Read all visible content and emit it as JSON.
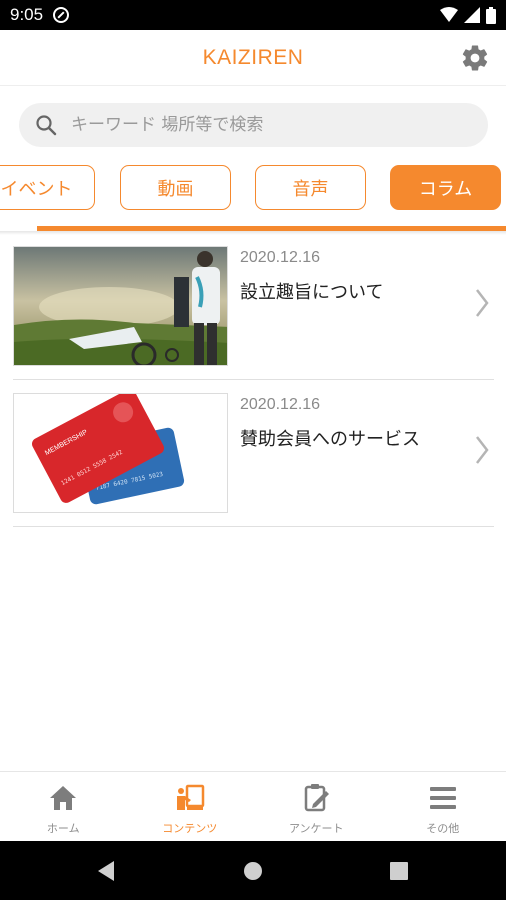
{
  "status_bar": {
    "time": "9:05"
  },
  "header": {
    "title": "KAIZIREN"
  },
  "search": {
    "placeholder": "キーワード 場所等で検索"
  },
  "tabs": [
    {
      "label": "イベント",
      "active": false
    },
    {
      "label": "動画",
      "active": false
    },
    {
      "label": "音声",
      "active": false
    },
    {
      "label": "コラム",
      "active": true
    }
  ],
  "articles": [
    {
      "date": "2020.12.16",
      "title": "設立趣旨について",
      "thumbnail": "wheelchair-photo"
    },
    {
      "date": "2020.12.16",
      "title": "賛助会員へのサービス",
      "thumbnail": "membership-cards"
    }
  ],
  "thumbnail_text": {
    "card_red_header": "MEMBERSHIP",
    "card_red_number": "1241 0512 5558 2542",
    "card_blue_number": "7187 6420 7815 5023"
  },
  "bottom_nav": [
    {
      "label": "ホーム",
      "icon": "home-icon",
      "active": false
    },
    {
      "label": "コンテンツ",
      "icon": "contents-icon",
      "active": true
    },
    {
      "label": "アンケート",
      "icon": "survey-icon",
      "active": false
    },
    {
      "label": "その他",
      "icon": "menu-icon",
      "active": false
    }
  ],
  "colors": {
    "accent": "#f5892e",
    "tab_indicator": "#f5892e",
    "inactive_nav": "#8e8e8e"
  }
}
